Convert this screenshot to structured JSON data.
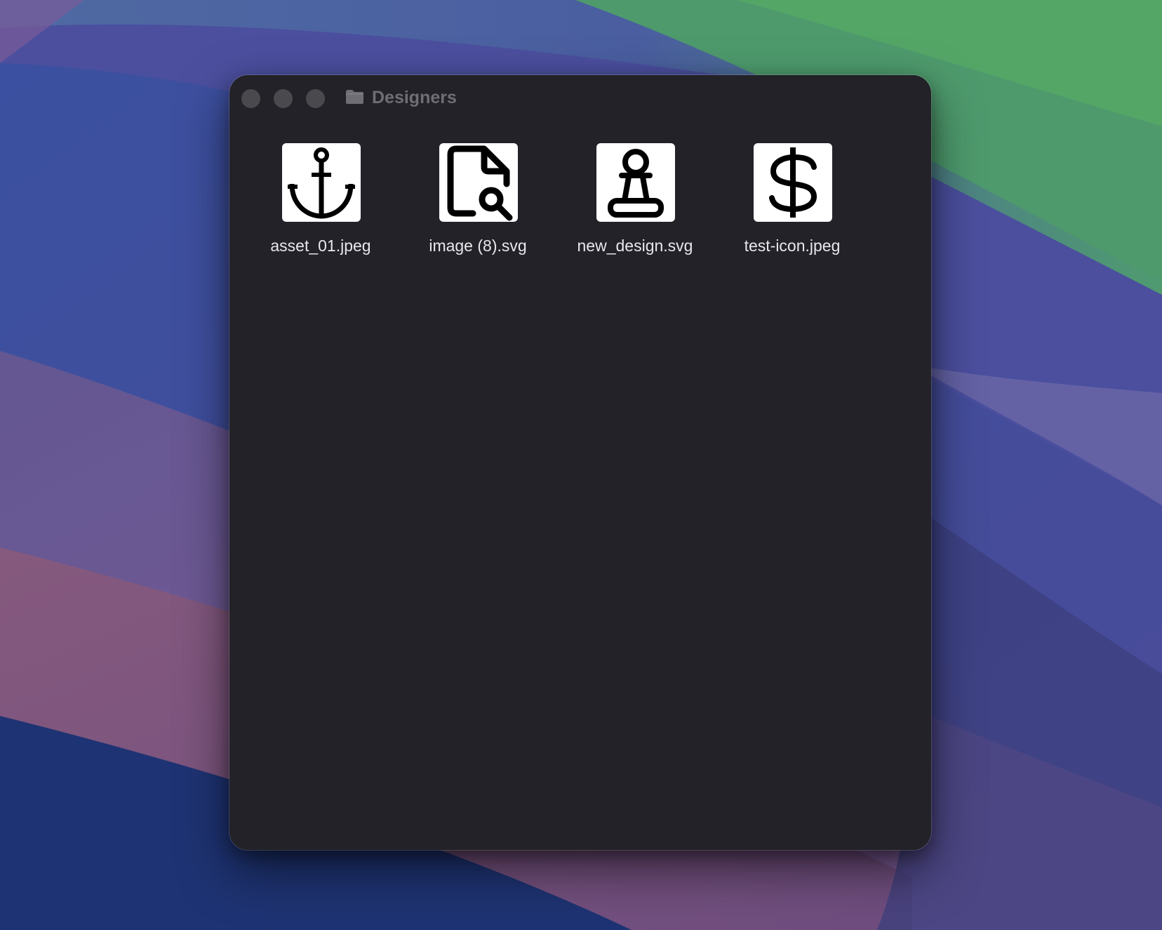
{
  "window": {
    "title": "Designers",
    "folder_icon": "folder-icon",
    "controls": [
      "close",
      "minimize",
      "zoom"
    ],
    "background_color": "#232228"
  },
  "files": [
    {
      "name": "asset_01.jpeg",
      "icon": "anchor-icon"
    },
    {
      "name": "image (8).svg",
      "icon": "file-search-icon"
    },
    {
      "name": "new_design.svg",
      "icon": "chess-pawn-icon"
    },
    {
      "name": "test-icon.jpeg",
      "icon": "dollar-sign-icon"
    }
  ]
}
